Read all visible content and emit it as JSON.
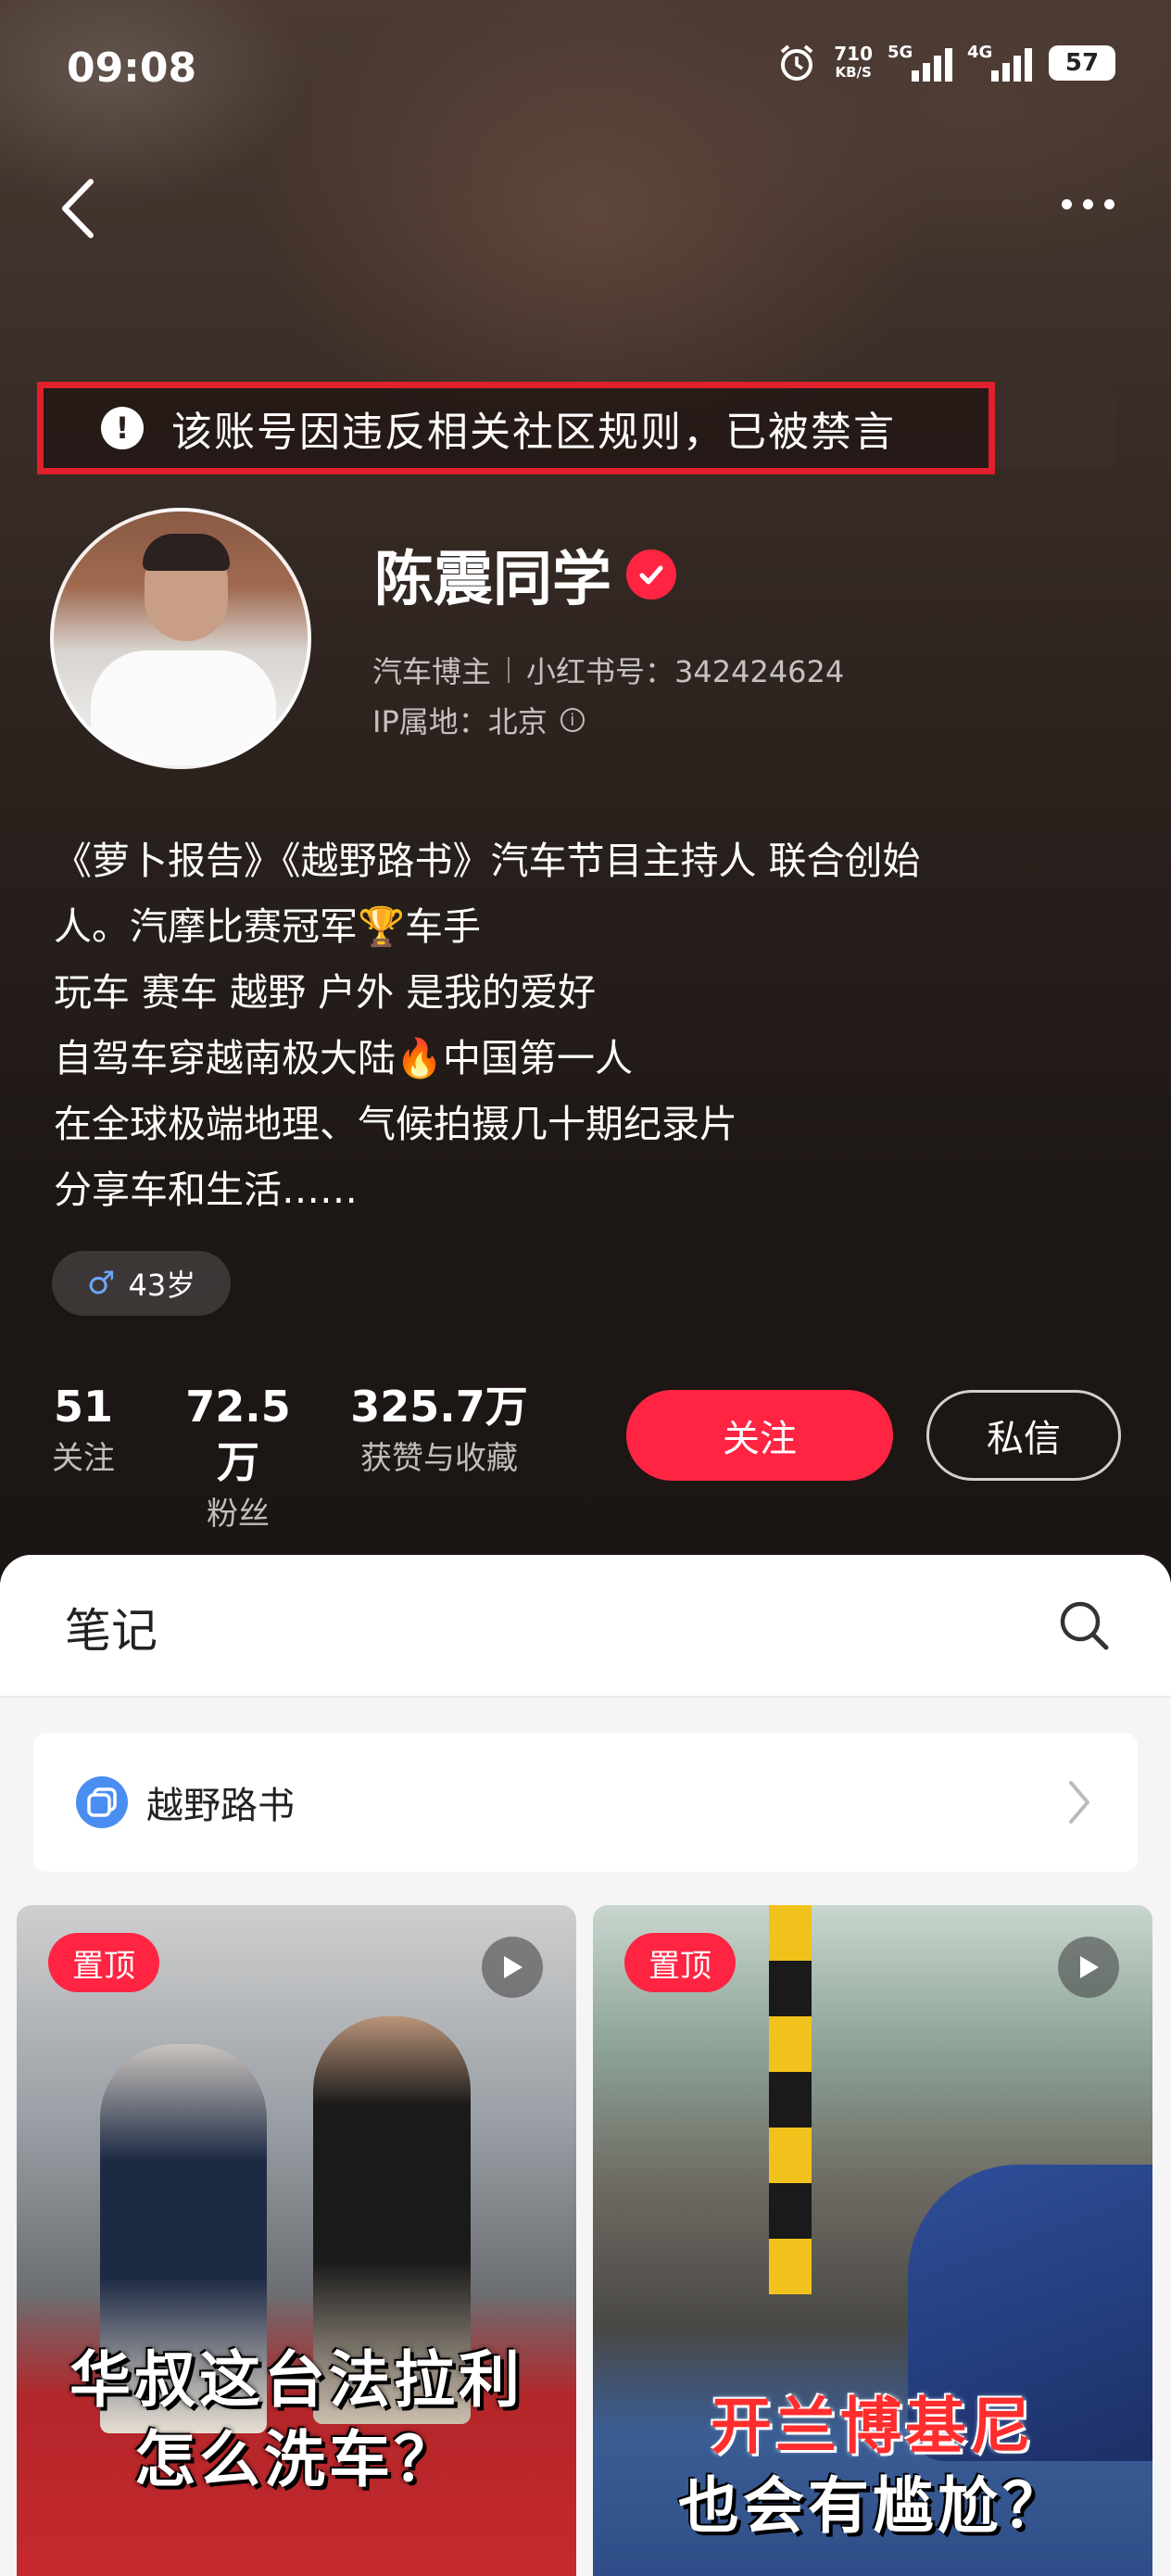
{
  "status_bar": {
    "time": "09:08",
    "net_speed_value": "710",
    "net_speed_unit": "KB/S",
    "sig1_label": "5G",
    "sig2_label": "4G",
    "battery": "57"
  },
  "ban_notice": {
    "text": "该账号因违反相关社区规则，已被禁言"
  },
  "profile": {
    "name": "陈震同学",
    "category": "汽车博主",
    "red_id": "小红书号：342424624",
    "ip_location": "IP属地：北京",
    "bio_lines": [
      "《萝卜报告》《越野路书》汽车节目主持人 联合创始",
      "人。汽摩比赛冠军🏆车手",
      "玩车 赛车 越野 户外 是我的爱好",
      "自驾车穿越南极大陆🔥中国第一人",
      "在全球极端地理、气候拍摄几十期纪录片",
      "分享车和生活……"
    ],
    "age": "43岁"
  },
  "stats": [
    {
      "value": "51",
      "label": "关注"
    },
    {
      "value": "72.5万",
      "label": "粉丝"
    },
    {
      "value": "325.7万",
      "label": "获赞与收藏"
    }
  ],
  "actions": {
    "follow": "关注",
    "message": "私信"
  },
  "notes_section": {
    "title": "笔记",
    "collection_label": "越野路书"
  },
  "cards": [
    {
      "badge": "置顶",
      "title_line1": "华叔这台法拉利",
      "title_line2": "怎么洗车？"
    },
    {
      "badge": "置顶",
      "title_line1": "开兰博基尼",
      "title_line2": "也会有尴尬？"
    }
  ],
  "colors": {
    "accent": "#ff2442",
    "ban_border": "#e0202c"
  }
}
